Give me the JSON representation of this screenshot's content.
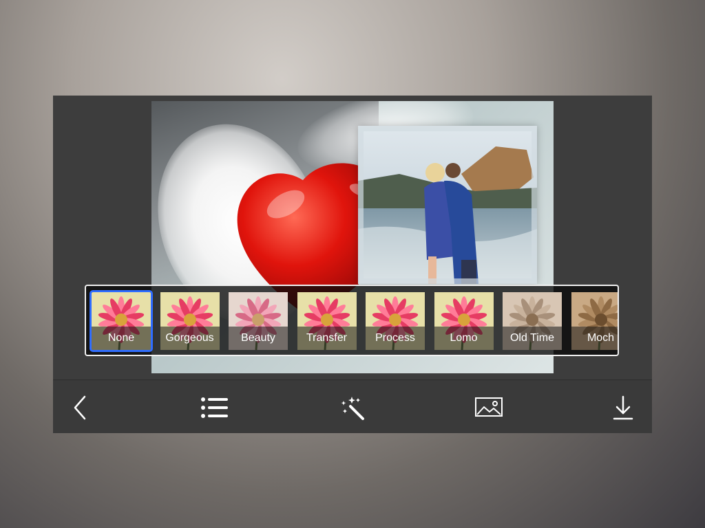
{
  "filters": [
    {
      "label": "None",
      "tone": "vivid",
      "selected": true
    },
    {
      "label": "Gorgeous",
      "tone": "vivid",
      "selected": false
    },
    {
      "label": "Beauty",
      "tone": "soft",
      "selected": false
    },
    {
      "label": "Transfer",
      "tone": "vivid",
      "selected": false
    },
    {
      "label": "Process",
      "tone": "vivid",
      "selected": false
    },
    {
      "label": "Lomo",
      "tone": "vivid",
      "selected": false
    },
    {
      "label": "Old Time",
      "tone": "sepia",
      "selected": false
    },
    {
      "label": "Moch",
      "tone": "sepia-dark",
      "selected": false
    }
  ],
  "toolbar": {
    "icons": [
      "back-chevron-icon",
      "list-icon",
      "magic-wand-icon",
      "image-icon",
      "download-icon"
    ]
  },
  "colors": {
    "selected_outline": "#2f6dff",
    "toolbar_bg": "#3a3a3a",
    "app_bg": "#3d3d3d"
  }
}
